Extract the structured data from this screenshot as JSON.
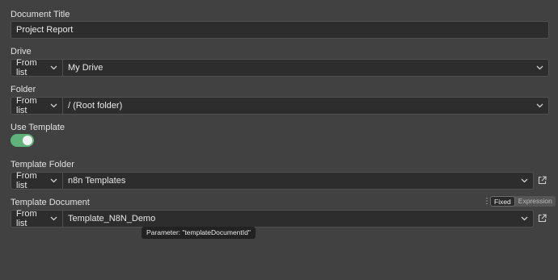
{
  "document_title": {
    "label": "Document Title",
    "value": "Project Report"
  },
  "drive": {
    "label": "Drive",
    "mode": "From list",
    "value": "My Drive"
  },
  "folder": {
    "label": "Folder",
    "mode": "From list",
    "value": "/ (Root folder)"
  },
  "use_template": {
    "label": "Use Template",
    "enabled": true,
    "accent": "#5fb37a"
  },
  "template_folder": {
    "label": "Template Folder",
    "mode": "From list",
    "value": "n8n Templates",
    "link_icon": "external-link-icon"
  },
  "template_document": {
    "label": "Template Document",
    "mode": "From list",
    "value": "Template_N8N_Demo",
    "link_icon": "external-link-icon",
    "toggle": {
      "fixed": "Fixed",
      "expression": "Expression",
      "selected": "Fixed"
    },
    "menu_icon": "vertical-dots-icon"
  },
  "tooltip": "Parameter: \"templateDocumentId\""
}
